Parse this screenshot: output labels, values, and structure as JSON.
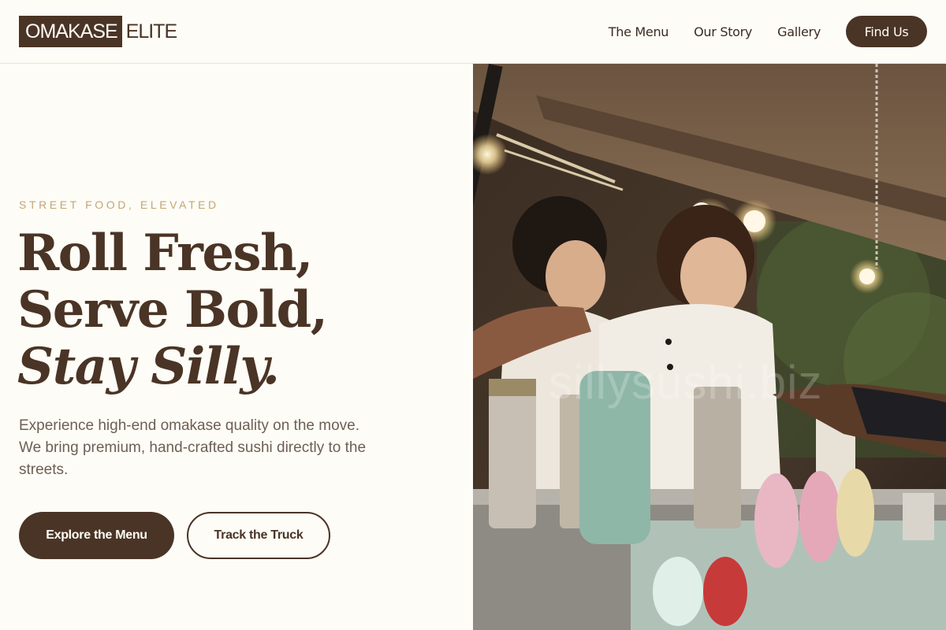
{
  "header": {
    "logo_primary": "OMAKASE",
    "logo_secondary": "ELITE",
    "nav": [
      "The Menu",
      "Our Story",
      "Gallery"
    ],
    "cta": "Find Us"
  },
  "hero": {
    "eyebrow": "STREET FOOD, ELEVATED",
    "headline_line1": "Roll Fresh,",
    "headline_line2": "Serve Bold,",
    "headline_line3": "Stay Silly.",
    "subtext": "Experience high-end omakase quality on the move. We bring premium, hand-crafted sushi directly to the streets.",
    "primary_button": "Explore the Menu",
    "secondary_button": "Track the Truck"
  },
  "image": {
    "watermark": "sillysushi.biz"
  },
  "colors": {
    "brand_brown": "#4a3426",
    "background": "#fdfcf6",
    "accent_gold": "#c2a677"
  }
}
